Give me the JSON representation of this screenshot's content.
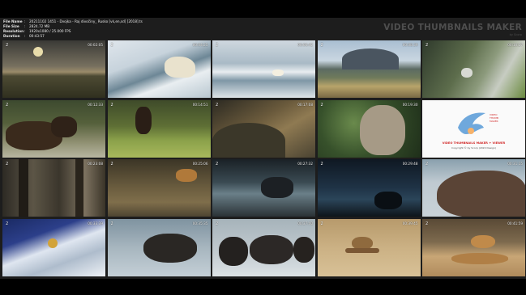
{
  "file_info": {
    "rows": [
      {
        "key": "File Name",
        "value": "20211102 1451 - Dvojka - Raj divočiny_ Rusko [vk,en,sd] [2018].ts"
      },
      {
        "key": "File Size",
        "value": "2824.72 MB"
      },
      {
        "key": "Resolution",
        "value": "1920x1080 / 25.000 FPS"
      },
      {
        "key": "Duration",
        "value": "00:43:57"
      }
    ]
  },
  "brand": {
    "title": "VIDEO THUMBNAILS MAKER",
    "subtitle": "by Scorp"
  },
  "thumbnails": [
    {
      "num": "2",
      "time": "00:02:05",
      "scene": "sunset-over-wetland"
    },
    {
      "num": "2",
      "time": "00:04:25",
      "scene": "polar-bear-in-ice"
    },
    {
      "num": "2",
      "time": "00:06:42",
      "scene": "polar-bear-on-ice-floes"
    },
    {
      "num": "2",
      "time": "00:08:39",
      "scene": "mountain-lake"
    },
    {
      "num": "2",
      "time": "00:10:27",
      "scene": "bird-on-rocky-hill"
    },
    {
      "num": "2",
      "time": "00:12:33",
      "scene": "brown-bears-walking"
    },
    {
      "num": "2",
      "time": "00:14:51",
      "scene": "bear-in-grass"
    },
    {
      "num": "2",
      "time": "00:17:08",
      "scene": "rocky-hillside"
    },
    {
      "num": "2",
      "time": "00:19:30",
      "scene": "owl-closeup"
    },
    {
      "num": "",
      "time": "",
      "scene": "promo"
    },
    {
      "num": "2",
      "time": "00:23:08",
      "scene": "forest-trunks"
    },
    {
      "num": "2",
      "time": "00:25:06",
      "scene": "forest-tiger"
    },
    {
      "num": "2",
      "time": "00:27:32",
      "scene": "stream-animal"
    },
    {
      "num": "2",
      "time": "00:29:48",
      "scene": "night-rocks"
    },
    {
      "num": "2",
      "time": "00:31:15",
      "scene": "seal-closeup"
    },
    {
      "num": "2",
      "time": "00:33:39",
      "scene": "aerial-ice"
    },
    {
      "num": "2",
      "time": "00:35:35",
      "scene": "muskox-in-snow"
    },
    {
      "num": "2",
      "time": "00:37:40",
      "scene": "muskox-herd"
    },
    {
      "num": "2",
      "time": "00:39:45",
      "scene": "lizard-on-sand"
    },
    {
      "num": "2",
      "time": "00:41:59",
      "scene": "lizards-on-rock"
    }
  ],
  "promo": {
    "line1": "VIDEO THUMBNAILS MAKER + VIEWER",
    "line2": "Copyright © by Scorp (2020 Design)",
    "side": "VIDEO\nTHUMB\nMAKER"
  },
  "colors": {
    "sheet_background": "#1d1d1d",
    "page_background": "#000000",
    "brand_text": "#4e4e4e"
  }
}
